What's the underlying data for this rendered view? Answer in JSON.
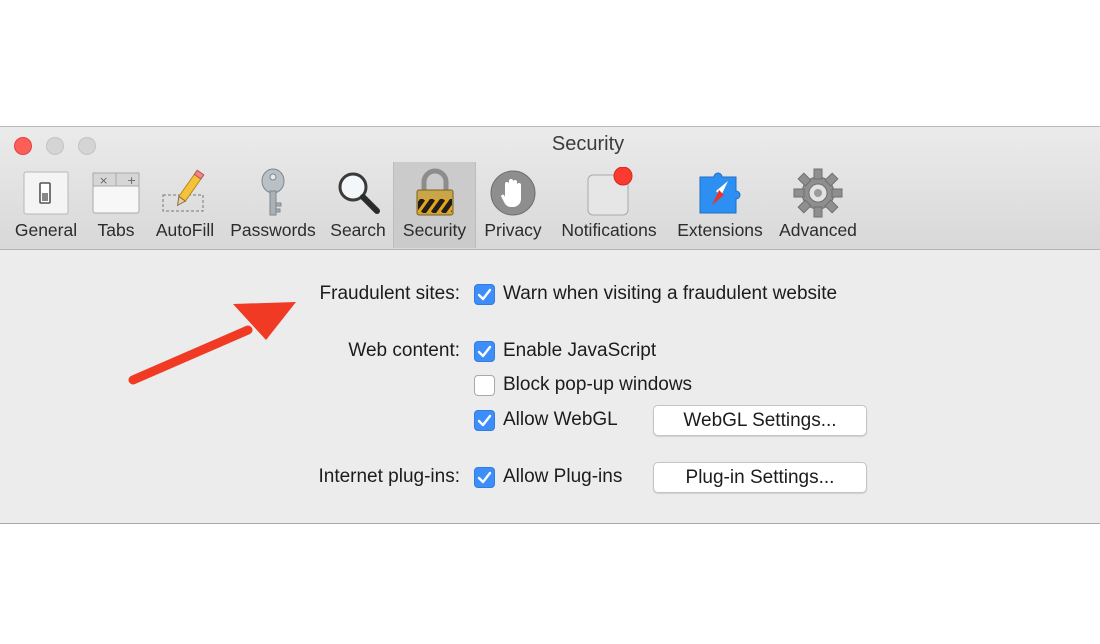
{
  "window": {
    "title": "Security"
  },
  "toolbar": {
    "tabs": [
      {
        "label": "General",
        "icon": "general-switch-icon"
      },
      {
        "label": "Tabs",
        "icon": "tabs-icon"
      },
      {
        "label": "AutoFill",
        "icon": "pencil-icon"
      },
      {
        "label": "Passwords",
        "icon": "key-icon"
      },
      {
        "label": "Search",
        "icon": "magnifier-icon"
      },
      {
        "label": "Security",
        "icon": "padlock-icon",
        "selected": true
      },
      {
        "label": "Privacy",
        "icon": "hand-icon"
      },
      {
        "label": "Notifications",
        "icon": "notification-badge-icon"
      },
      {
        "label": "Extensions",
        "icon": "puzzle-compass-icon"
      },
      {
        "label": "Advanced",
        "icon": "gear-icon"
      }
    ]
  },
  "settings": {
    "fraudulent": {
      "label": "Fraudulent sites:",
      "option": "Warn when visiting a fraudulent website",
      "checked": true
    },
    "web_content": {
      "label": "Web content:",
      "js": {
        "option": "Enable JavaScript",
        "checked": true
      },
      "popups": {
        "option": "Block pop-up windows",
        "checked": false
      },
      "webgl": {
        "option": "Allow WebGL",
        "checked": true,
        "button": "WebGL Settings..."
      }
    },
    "plugins": {
      "label": "Internet plug-ins:",
      "option": "Allow Plug-ins",
      "checked": true,
      "button": "Plug-in Settings..."
    }
  },
  "colors": {
    "annotation_arrow": "#f03a24",
    "checkbox_on": "#3d8ef8",
    "close_button": "#fc5f57",
    "notification_badge": "#fb3b30"
  }
}
